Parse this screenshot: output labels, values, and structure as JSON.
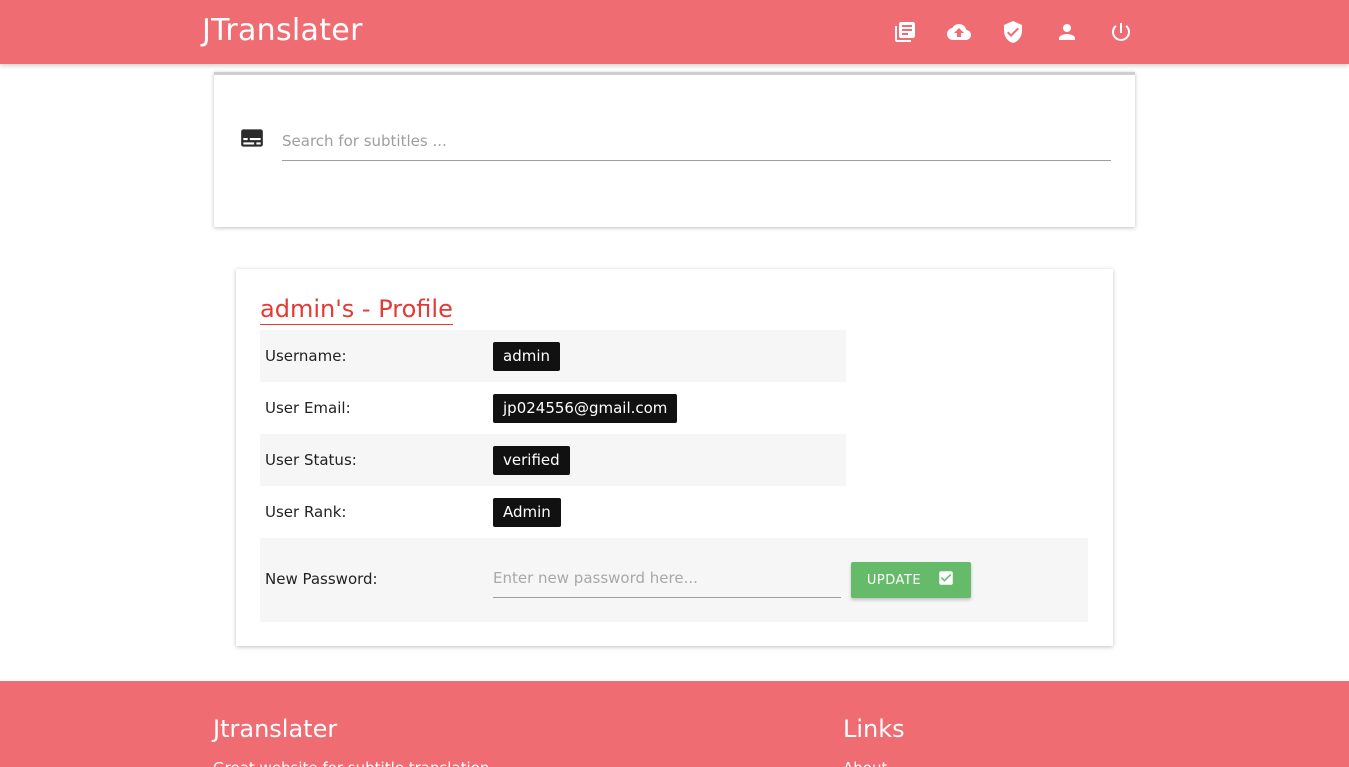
{
  "navbar": {
    "brand": "JTranslater",
    "icons": [
      "library-icon",
      "cloud-upload-icon",
      "shield-check-icon",
      "account-icon",
      "power-icon"
    ]
  },
  "search": {
    "icon": "subtitles-icon",
    "placeholder": "Search for subtitles ..."
  },
  "profile": {
    "title": "admin's - Profile",
    "fields": [
      {
        "label": "Username:",
        "value": "admin"
      },
      {
        "label": "User Email:",
        "value": "jp024556@gmail.com"
      },
      {
        "label": "User Status:",
        "value": "verified"
      },
      {
        "label": "User Rank:",
        "value": "Admin"
      }
    ],
    "password": {
      "label": "New Password:",
      "placeholder": "Enter new password here...",
      "button_label": "UPDATE"
    }
  },
  "footer": {
    "title": "Jtranslater",
    "text": "Great website for subtitle translation",
    "links_title": "Links",
    "link_first": "About"
  },
  "colors": {
    "primary": "#ef6c72",
    "accent_red": "#e53935",
    "button_green": "#66bb6a",
    "chip_bg": "#111111"
  }
}
